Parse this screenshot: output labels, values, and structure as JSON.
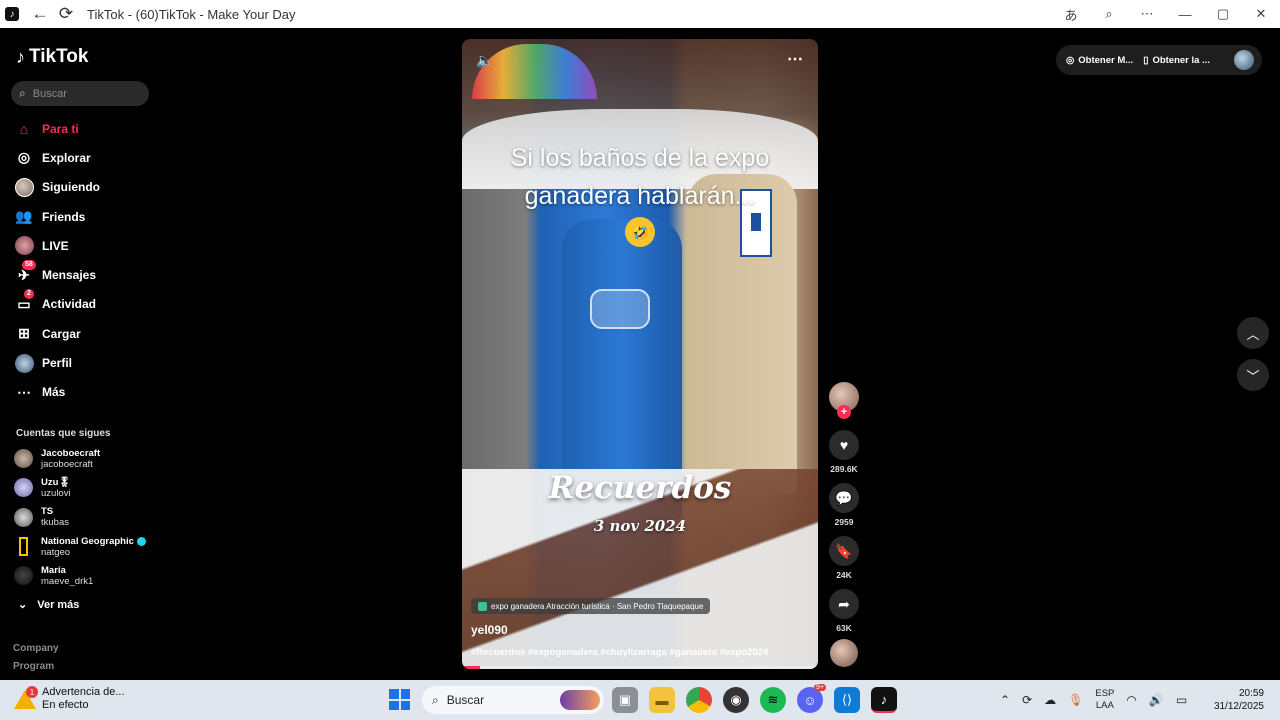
{
  "titlebar": {
    "title": "TikTok - (60)TikTok - Make Your Day",
    "app_icon": "tiktok-icon",
    "buttons": [
      "back-icon",
      "refresh-icon",
      "translate-icon",
      "zoom-icon",
      "more-icon",
      "minimize-icon",
      "maximize-icon",
      "close-icon"
    ]
  },
  "sidebar": {
    "logo": "TikTok",
    "search_placeholder": "Buscar",
    "nav": [
      {
        "label": "Para ti",
        "icon": "home-icon",
        "active": true
      },
      {
        "label": "Explorar",
        "icon": "compass-icon"
      },
      {
        "label": "Siguiendo",
        "icon": "following-avatar-icon"
      },
      {
        "label": "Friends",
        "icon": "friends-icon"
      },
      {
        "label": "LIVE",
        "icon": "live-avatar-icon"
      },
      {
        "label": "Mensajes",
        "icon": "messages-icon",
        "badge": "58"
      },
      {
        "label": "Actividad",
        "icon": "activity-icon",
        "badge": "2"
      },
      {
        "label": "Cargar",
        "icon": "upload-icon"
      },
      {
        "label": "Perfil",
        "icon": "profile-avatar-icon"
      },
      {
        "label": "Más",
        "icon": "more-icon"
      }
    ],
    "following_title": "Cuentas que sigues",
    "following": [
      {
        "name": "Jacoboecraft",
        "user": "jacoboecraft"
      },
      {
        "name": "Uzu🎖",
        "user": "uzulovi"
      },
      {
        "name": "TS",
        "user": "tkubas"
      },
      {
        "name": "National Geographic",
        "user": "natgeo",
        "verified": true
      },
      {
        "name": "María",
        "user": "maeve_drk1"
      }
    ],
    "see_more": "Ver más",
    "footer": [
      "Company",
      "Program"
    ]
  },
  "video": {
    "overlay_line1": "Si los baños de la expo",
    "overlay_line2": "ganadera hablarán...",
    "emoji": "🤣",
    "title_text": "Recuerdos",
    "date_text": "3 nov 2024",
    "location": "expo ganadera Atracción turística · San Pedro Tlaquepaque",
    "author": "yel090",
    "hashtags": "#Recuerdos #expoganadera #chuylizarraga #ganadera #expo2024",
    "progress": 0.05
  },
  "actions": {
    "likes": "289.6K",
    "comments": "2959",
    "saves": "24K",
    "shares": "63K"
  },
  "topright": {
    "item1": "Obtener M...",
    "item2": "Obtener la ..."
  },
  "taskbar": {
    "notification_title": "Advertencia de...",
    "notification_sub": "En efecto",
    "notification_badge": "1",
    "search_label": "Buscar",
    "lang_line1": "ESP",
    "lang_line2": "LAA",
    "time": "20:59",
    "date": "31/12/2025",
    "discord_badge": "9+"
  },
  "colors": {
    "accent": "#fe2c55",
    "taskbar": "#dfe6ee"
  }
}
